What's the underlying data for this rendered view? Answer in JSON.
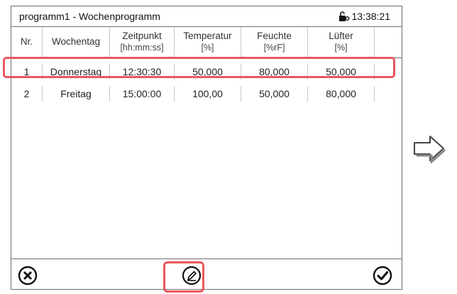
{
  "header": {
    "title": "programm1 - Wochenprogramm",
    "time": "13:38:21",
    "lock_icon": "lock-icon"
  },
  "table": {
    "columns": [
      {
        "label": "Nr.",
        "unit": ""
      },
      {
        "label": "Wochentag",
        "unit": ""
      },
      {
        "label": "Zeitpunkt",
        "unit": "[hh:mm:ss]"
      },
      {
        "label": "Temperatur",
        "unit": "[%]"
      },
      {
        "label": "Feuchte",
        "unit": "[%rF]"
      },
      {
        "label": "Lüfter",
        "unit": "[%]"
      }
    ],
    "rows": [
      {
        "nr": "1",
        "day": "Donnerstag",
        "time": "12:30:30",
        "temp": "50,000",
        "hum": "80,000",
        "fan": "50,000"
      },
      {
        "nr": "2",
        "day": "Freitag",
        "time": "15:00:00",
        "temp": "100,00",
        "hum": "50,000",
        "fan": "80,000"
      }
    ],
    "selected_row": "2"
  },
  "footer": {
    "cancel_icon": "close-circle-icon",
    "edit_icon": "edit-icon",
    "confirm_icon": "check-circle-icon"
  },
  "side": {
    "next_icon": "arrow-right-icon"
  },
  "colors": {
    "highlight": "#e8575d",
    "border": "#6e6e6e"
  }
}
